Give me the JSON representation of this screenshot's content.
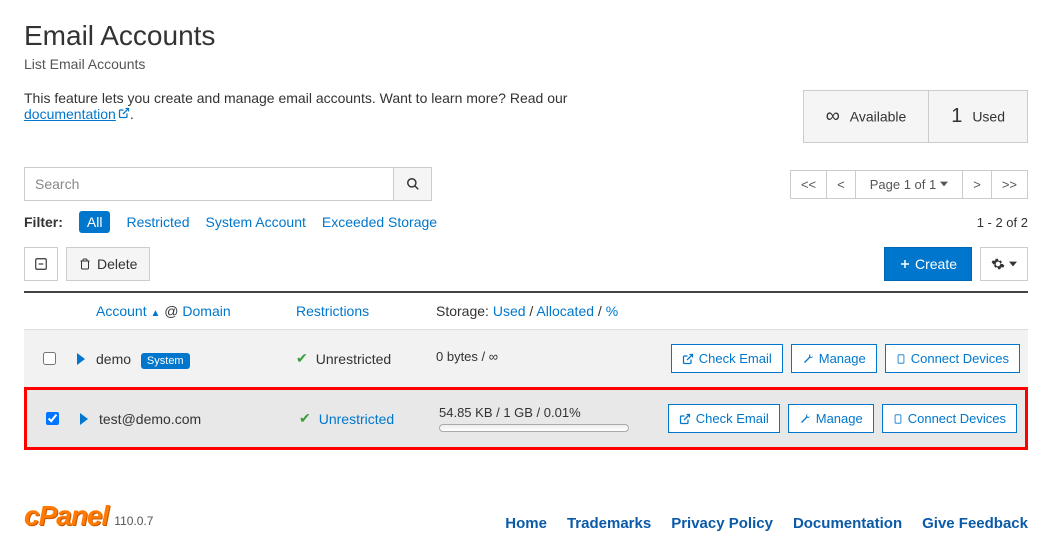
{
  "header": {
    "title": "Email Accounts",
    "subtitle": "List Email Accounts"
  },
  "intro": {
    "text_before_link": "This feature lets you create and manage email accounts. Want to learn more? Read our ",
    "link_text": "documentation",
    "period": "."
  },
  "stats": {
    "available_num": "∞",
    "available_label": "Available",
    "used_num": "1",
    "used_label": "Used"
  },
  "search": {
    "placeholder": "Search"
  },
  "pager": {
    "first": "<<",
    "prev": "<",
    "label": "Page 1 of 1",
    "next": ">",
    "last": ">>"
  },
  "filter": {
    "label": "Filter:",
    "items": [
      "All",
      "Restricted",
      "System Account",
      "Exceeded Storage"
    ],
    "active_index": 0
  },
  "count_text": "1 - 2 of 2",
  "actions": {
    "delete": "Delete",
    "create": "Create"
  },
  "columns": {
    "account_link": "Account",
    "at": "@",
    "domain": "Domain",
    "restrictions": "Restrictions",
    "storage_label": "Storage:",
    "used": "Used",
    "allocated": "Allocated",
    "pct": "%",
    "sep": " / "
  },
  "rows": [
    {
      "checked": false,
      "account": "demo",
      "system_badge": "System",
      "restriction_text": "Unrestricted",
      "restriction_link": false,
      "storage_text": "0 bytes / ∞",
      "has_progress": false
    },
    {
      "checked": true,
      "account": "test@demo.com",
      "system_badge": null,
      "restriction_text": "Unrestricted",
      "restriction_link": true,
      "storage_text": "54.85 KB / 1 GB / 0.01%",
      "has_progress": true
    }
  ],
  "row_actions": {
    "check_email": "Check Email",
    "manage": "Manage",
    "connect": "Connect Devices"
  },
  "footer": {
    "logo": "cPanel",
    "version": "110.0.7",
    "links": [
      "Home",
      "Trademarks",
      "Privacy Policy",
      "Documentation",
      "Give Feedback"
    ]
  }
}
